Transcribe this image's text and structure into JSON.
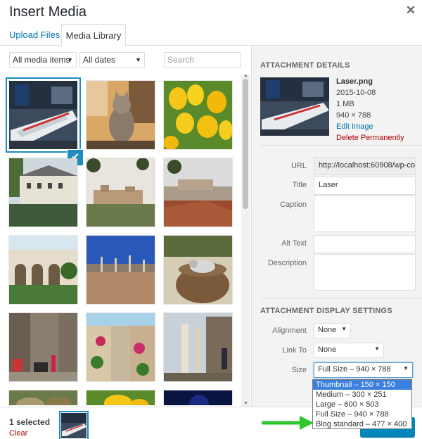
{
  "modal": {
    "title": "Insert Media",
    "close_icon": "close-icon"
  },
  "tabs": [
    {
      "label": "Upload Files",
      "active": false
    },
    {
      "label": "Media Library",
      "active": true
    }
  ],
  "filters": {
    "type": "All media items",
    "date": "All dates",
    "search_placeholder": "Search"
  },
  "grid": {
    "thumbnails": [
      "Laser boat",
      "Cat",
      "Yellow tulips",
      "Canal houses",
      "Hilltop castle",
      "Alhambra view",
      "Arched courtyard",
      "Ruins plaza",
      "Cat in barrel",
      "Stone street",
      "Flower alley",
      "Columns ruins",
      "Food",
      "Yellow flowers",
      "Night sky"
    ],
    "selected_index": 0
  },
  "details": {
    "heading": "Attachment Details",
    "filename": "Laser.png",
    "date": "2015-10-08",
    "size": "1 MB",
    "dimensions": "940 × 788",
    "edit_link": "Edit Image",
    "delete_link": "Delete Permanently",
    "url_label": "URL",
    "url_value": "http://localhost:60908/wp-co",
    "title_label": "Title",
    "title_value": "Laser",
    "caption_label": "Caption",
    "alt_label": "Alt Text",
    "description_label": "Description"
  },
  "display_settings": {
    "heading": "Attachment Display Settings",
    "alignment_label": "Alignment",
    "alignment_value": "None",
    "link_label": "Link To",
    "link_value": "None",
    "size_label": "Size",
    "size_value": "Full Size – 940 × 788",
    "size_options": [
      "Thumbnail – 150 × 150",
      "Medium – 300 × 251",
      "Large – 600 × 503",
      "Full Size – 940 × 788",
      "Blog standard – 477 × 400"
    ],
    "highlighted_option": 0
  },
  "footer": {
    "selected_count": "1 selected",
    "clear_label": "Clear"
  },
  "colors": {
    "accent": "#0073aa",
    "selection_blue": "#1e8cbe",
    "delete_red": "#a00",
    "insert_button": "#0085ba",
    "annotation_arrow": "#2ec72e"
  }
}
